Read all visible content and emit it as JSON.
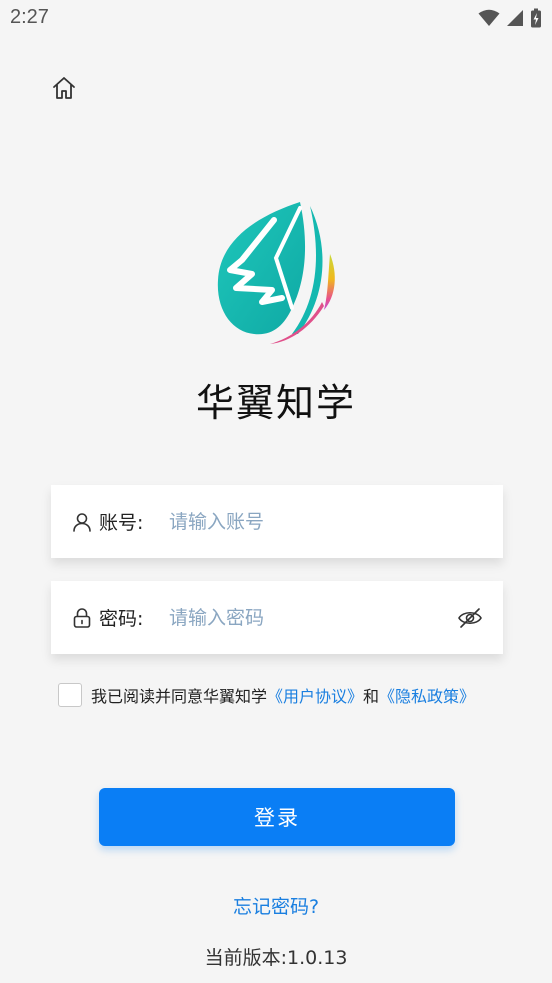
{
  "status_bar": {
    "time": "2:27"
  },
  "app": {
    "name": "华翼知学"
  },
  "account": {
    "label": "账号:",
    "placeholder": "请输入账号",
    "value": ""
  },
  "password": {
    "label": "密码:",
    "placeholder": "请输入密码",
    "value": ""
  },
  "agreement": {
    "checked": false,
    "prefix": "我已阅读并同意华翼知学",
    "user_agreement": "《用户协议》",
    "conjunction": "和",
    "privacy_policy": "《隐私政策》"
  },
  "login_button": {
    "label": "登录"
  },
  "forgot_password": {
    "label": "忘记密码?"
  },
  "version": {
    "label": "当前版本:1.0.13"
  },
  "colors": {
    "background": "#f5f5f5",
    "primary": "#0a7ef5",
    "link": "#1a7fe0",
    "placeholder": "#8aa6c1",
    "logo_teal": "#14b8b0",
    "logo_yellow": "#e8c21a",
    "logo_pink": "#e0508a"
  },
  "icons": {
    "home": "home-icon",
    "account": "user-icon",
    "password": "lock-icon",
    "visibility": "eye-off-icon",
    "wifi": "wifi-icon",
    "signal": "signal-icon",
    "battery": "battery-charging-icon"
  }
}
